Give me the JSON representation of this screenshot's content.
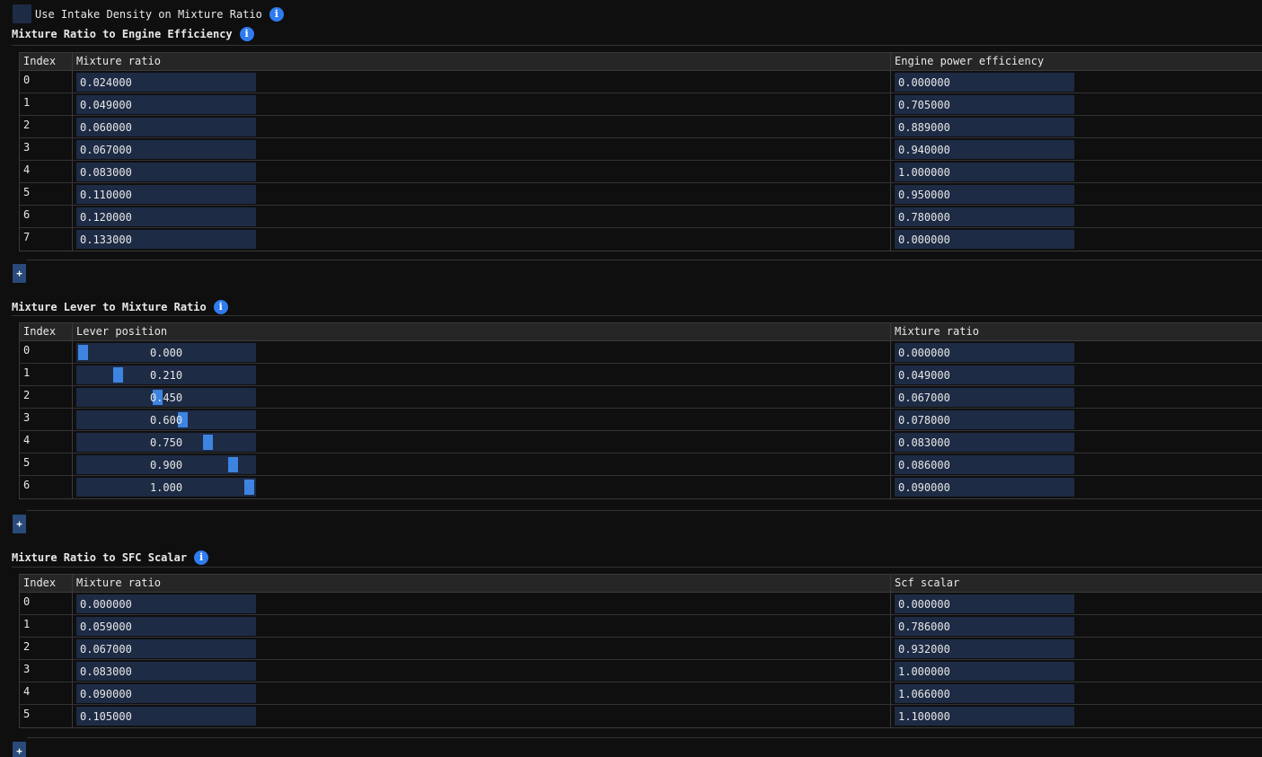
{
  "use_intake_density": {
    "label": "Use Intake Density on Mixture Ratio",
    "checked": false
  },
  "info_glyph": "i",
  "add_label": "+",
  "sections": [
    {
      "title": "Mixture Ratio to Engine Efficiency",
      "columns": [
        "Index",
        "Mixture ratio",
        "Engine power efficiency"
      ],
      "kind": "fields",
      "rows": [
        {
          "index": "0",
          "a": "0.024000",
          "b": "0.000000"
        },
        {
          "index": "1",
          "a": "0.049000",
          "b": "0.705000"
        },
        {
          "index": "2",
          "a": "0.060000",
          "b": "0.889000"
        },
        {
          "index": "3",
          "a": "0.067000",
          "b": "0.940000"
        },
        {
          "index": "4",
          "a": "0.083000",
          "b": "1.000000"
        },
        {
          "index": "5",
          "a": "0.110000",
          "b": "0.950000"
        },
        {
          "index": "6",
          "a": "0.120000",
          "b": "0.780000"
        },
        {
          "index": "7",
          "a": "0.133000",
          "b": "0.000000"
        }
      ]
    },
    {
      "title": "Mixture Lever to Mixture Ratio",
      "columns": [
        "Index",
        "Lever position",
        "Mixture ratio"
      ],
      "kind": "slider",
      "rows": [
        {
          "index": "0",
          "a": "0.000",
          "level": 0.0,
          "b": "0.000000"
        },
        {
          "index": "1",
          "a": "0.210",
          "level": 0.21,
          "b": "0.049000"
        },
        {
          "index": "2",
          "a": "0.450",
          "level": 0.45,
          "b": "0.067000"
        },
        {
          "index": "3",
          "a": "0.600",
          "level": 0.6,
          "b": "0.078000"
        },
        {
          "index": "4",
          "a": "0.750",
          "level": 0.75,
          "b": "0.083000"
        },
        {
          "index": "5",
          "a": "0.900",
          "level": 0.9,
          "b": "0.086000"
        },
        {
          "index": "6",
          "a": "1.000",
          "level": 1.0,
          "b": "0.090000"
        }
      ]
    },
    {
      "title": "Mixture Ratio to SFC Scalar",
      "columns": [
        "Index",
        "Mixture ratio",
        "Scf scalar"
      ],
      "kind": "fields",
      "rows": [
        {
          "index": "0",
          "a": "0.000000",
          "b": "0.000000"
        },
        {
          "index": "1",
          "a": "0.059000",
          "b": "0.786000"
        },
        {
          "index": "2",
          "a": "0.067000",
          "b": "0.932000"
        },
        {
          "index": "3",
          "a": "0.083000",
          "b": "1.000000"
        },
        {
          "index": "4",
          "a": "0.090000",
          "b": "1.066000"
        },
        {
          "index": "5",
          "a": "0.105000",
          "b": "1.100000"
        }
      ]
    }
  ],
  "colors": {
    "background": "#0f0f0f",
    "field": "#1e2b45",
    "accent": "#2f7cf0",
    "slider_grab": "#3d84e0",
    "add_button": "#294a7a"
  }
}
